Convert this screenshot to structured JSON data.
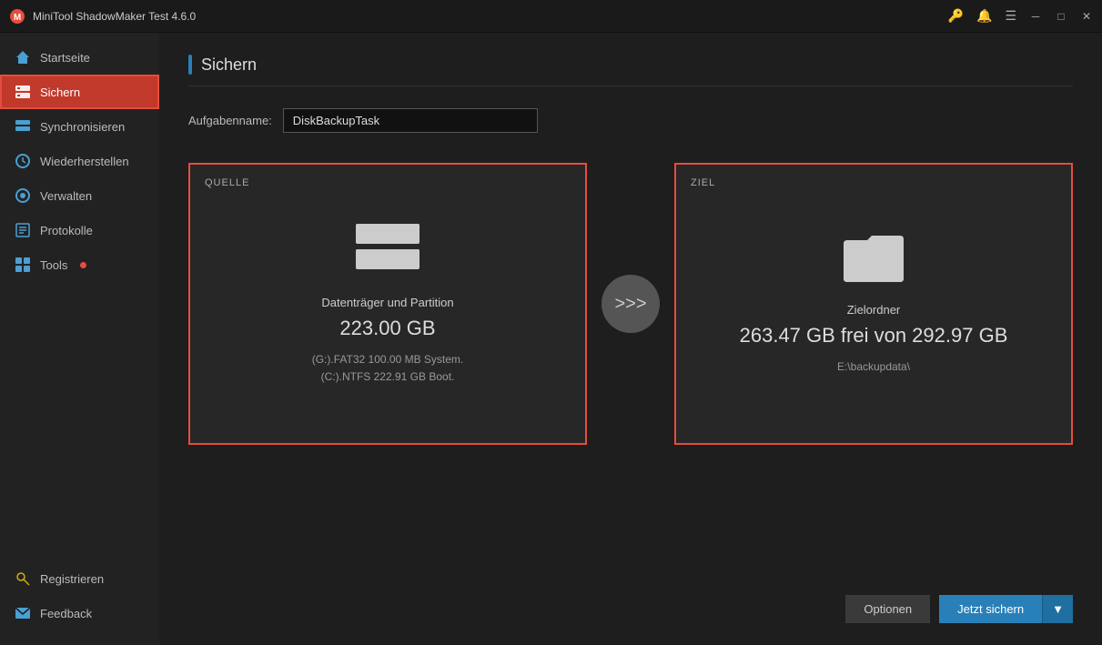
{
  "titlebar": {
    "title": "MiniTool ShadowMaker Test 4.6.0"
  },
  "sidebar": {
    "items": [
      {
        "id": "startseite",
        "label": "Startseite",
        "icon": "home-icon",
        "active": false
      },
      {
        "id": "sichern",
        "label": "Sichern",
        "icon": "backup-icon",
        "active": true
      },
      {
        "id": "synchronisieren",
        "label": "Synchronisieren",
        "icon": "sync-icon",
        "active": false
      },
      {
        "id": "wiederherstellen",
        "label": "Wiederherstellen",
        "icon": "restore-icon",
        "active": false
      },
      {
        "id": "verwalten",
        "label": "Verwalten",
        "icon": "manage-icon",
        "active": false
      },
      {
        "id": "protokolle",
        "label": "Protokolle",
        "icon": "log-icon",
        "active": false
      },
      {
        "id": "tools",
        "label": "Tools",
        "icon": "tools-icon",
        "active": false,
        "dot": true
      }
    ],
    "footer": [
      {
        "id": "registrieren",
        "label": "Registrieren",
        "icon": "key-icon"
      },
      {
        "id": "feedback",
        "label": "Feedback",
        "icon": "mail-icon"
      }
    ]
  },
  "main": {
    "page_title": "Sichern",
    "task_name_label": "Aufgabenname:",
    "task_name_value": "DiskBackupTask",
    "source": {
      "label": "QUELLE",
      "main_text": "Datenträger und Partition",
      "size_text": "223.00 GB",
      "detail_line1": "(G:).FAT32 100.00 MB System.",
      "detail_line2": "(C:).NTFS 222.91 GB Boot."
    },
    "destination": {
      "label": "ZIEL",
      "main_text": "Zielordner",
      "size_text": "263.47 GB frei von 292.97 GB",
      "detail_line1": "E:\\backupdata\\"
    },
    "arrow_symbol": ">>>",
    "btn_options": "Optionen",
    "btn_backup": "Jetzt sichern"
  }
}
